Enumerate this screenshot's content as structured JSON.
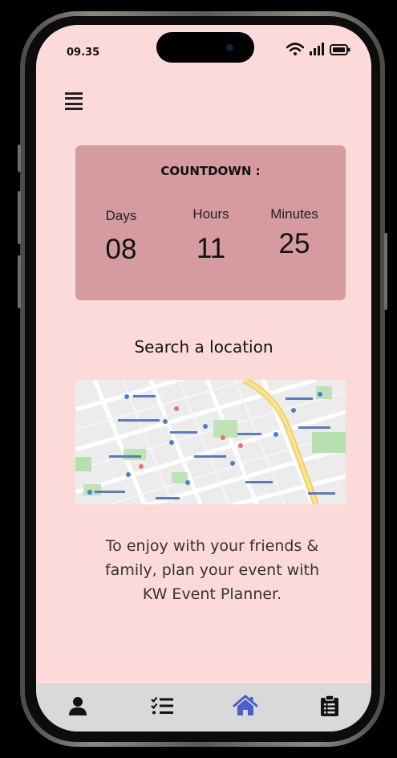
{
  "status_bar": {
    "time": "09.35"
  },
  "countdown": {
    "title": "COUNTDOWN :",
    "days_label": "Days",
    "hours_label": "Hours",
    "minutes_label": "Minutes",
    "days_value": "08",
    "hours_value": "11",
    "minutes_value": "25"
  },
  "search": {
    "label": "Search a location"
  },
  "info": {
    "text": "To enjoy with your friends & family, plan your event with KW Event Planner."
  },
  "tabs": [
    {
      "icon": "user-icon",
      "active": false
    },
    {
      "icon": "task-list-icon",
      "active": false
    },
    {
      "icon": "home-icon",
      "active": true
    },
    {
      "icon": "clipboard-icon",
      "active": false
    }
  ],
  "colors": {
    "background": "#fddada",
    "countdown_card": "#d69aa1",
    "tab_bar": "#d9d9d9",
    "active_tab": "#4a60c8"
  }
}
